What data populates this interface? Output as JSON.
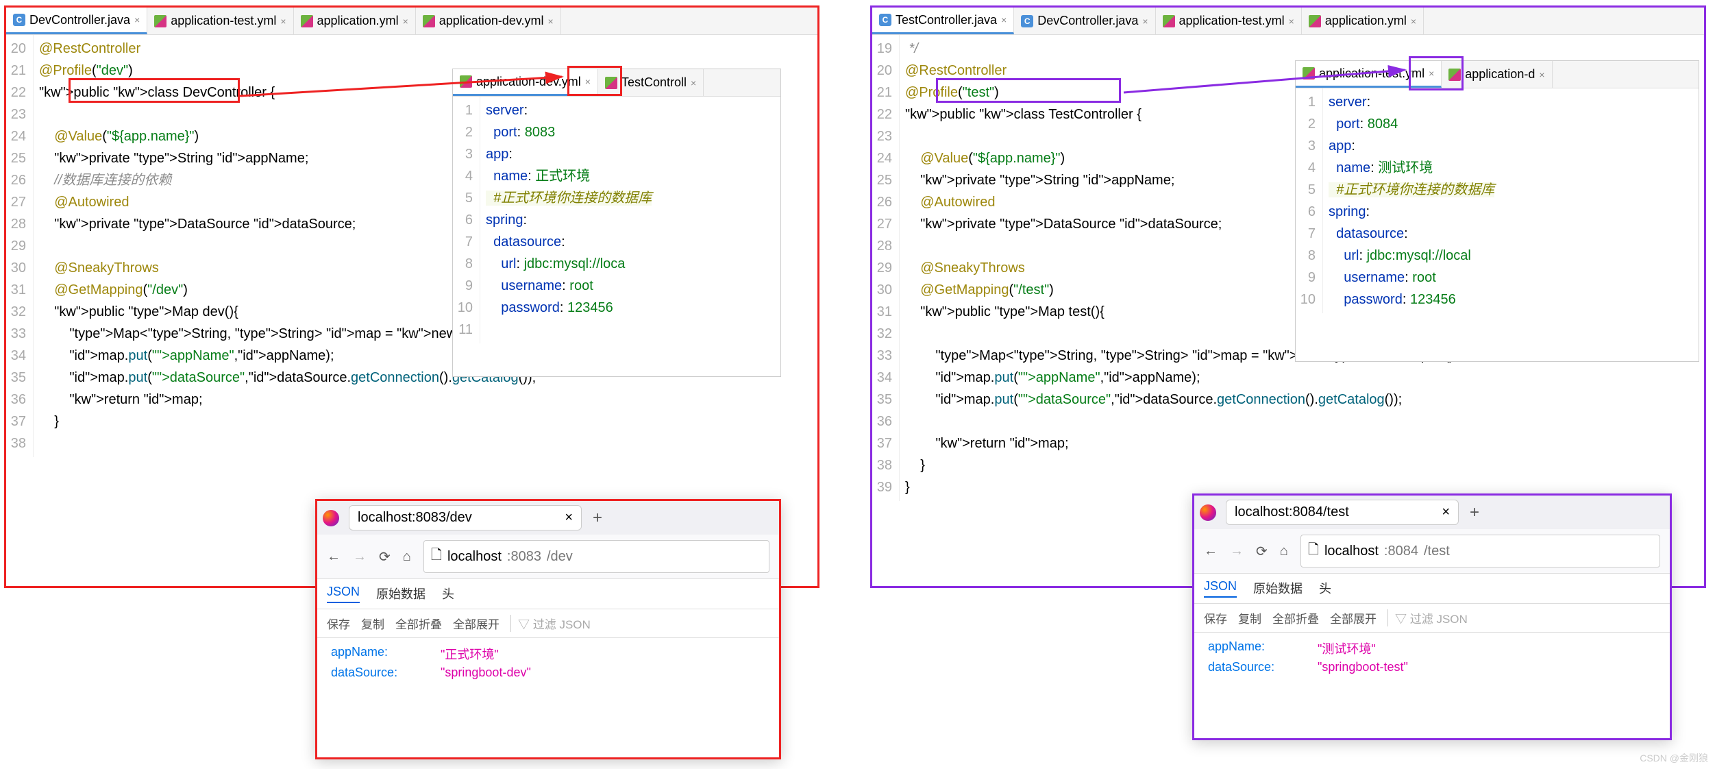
{
  "left": {
    "border_color": "#e22",
    "tabs": [
      "DevController.java",
      "application-test.yml",
      "application.yml",
      "application-dev.yml"
    ],
    "active_tab": 0,
    "code_start_line": 20,
    "code_lines": [
      {
        "n": 20,
        "t": "@RestController",
        "cls": "ann"
      },
      {
        "n": 21,
        "t": "@Profile(\"dev\")",
        "cls": "ann-str"
      },
      {
        "n": 22,
        "t": "public class DevController {",
        "cls": "sig"
      },
      {
        "n": 23,
        "t": "",
        "cls": ""
      },
      {
        "n": 24,
        "t": "    @Value(\"${app.name}\")",
        "cls": "ann-str"
      },
      {
        "n": 25,
        "t": "    private String appName;",
        "cls": "decl"
      },
      {
        "n": 26,
        "t": "    //数据库连接的依赖",
        "cls": "cmt"
      },
      {
        "n": 27,
        "t": "    @Autowired",
        "cls": "ann"
      },
      {
        "n": 28,
        "t": "    private DataSource dataSource;",
        "cls": "decl"
      },
      {
        "n": 29,
        "t": "",
        "cls": ""
      },
      {
        "n": 30,
        "t": "    @SneakyThrows",
        "cls": "ann"
      },
      {
        "n": 31,
        "t": "    @GetMapping(\"/dev\")",
        "cls": "ann-str"
      },
      {
        "n": 32,
        "t": "    public Map dev(){",
        "cls": "sig"
      },
      {
        "n": 33,
        "t": "        Map<String, String> map = new HashMap<>();",
        "cls": "stmt"
      },
      {
        "n": 34,
        "t": "        map.put(\"appName\",appName);",
        "cls": "stmt"
      },
      {
        "n": 35,
        "t": "        map.put(\"dataSource\",dataSource.getConnection().getCatalog());",
        "cls": "stmt"
      },
      {
        "n": 36,
        "t": "        return map;",
        "cls": "ret"
      },
      {
        "n": 37,
        "t": "    }",
        "cls": ""
      },
      {
        "n": 38,
        "t": "",
        "cls": ""
      }
    ],
    "yml": {
      "tabs": [
        "application-dev.yml",
        "TestControll"
      ],
      "lines": [
        {
          "n": 1,
          "t": "server:"
        },
        {
          "n": 2,
          "t": "  port: 8083"
        },
        {
          "n": 3,
          "t": "app:"
        },
        {
          "n": 4,
          "t": "  name: 正式环境"
        },
        {
          "n": 5,
          "t": "  #正式环境你连接的数据库",
          "cmt": true
        },
        {
          "n": 6,
          "t": "spring:"
        },
        {
          "n": 7,
          "t": "  datasource:"
        },
        {
          "n": 8,
          "t": "    url: jdbc:mysql://loca"
        },
        {
          "n": 9,
          "t": "    username: root"
        },
        {
          "n": 10,
          "t": "    password: 123456"
        },
        {
          "n": 11,
          "t": ""
        }
      ]
    },
    "browser": {
      "tab_title": "localhost:8083/dev",
      "url_host": "localhost",
      "url_port": ":8083",
      "url_path": "/dev",
      "subtabs": [
        "JSON",
        "原始数据",
        "头"
      ],
      "toolbar": [
        "保存",
        "复制",
        "全部折叠",
        "全部展开"
      ],
      "filter_ph": "过滤 JSON",
      "json": {
        "appName": "\"正式环境\"",
        "dataSource": "\"springboot-dev\""
      }
    }
  },
  "right": {
    "border_color": "#8a2be2",
    "tabs": [
      "TestController.java",
      "DevController.java",
      "application-test.yml",
      "application.yml"
    ],
    "active_tab": 0,
    "code_lines": [
      {
        "n": 19,
        "t": " */",
        "cls": "cmt"
      },
      {
        "n": 20,
        "t": "@RestController",
        "cls": "ann"
      },
      {
        "n": 21,
        "t": "@Profile(\"test\")",
        "cls": "ann-str"
      },
      {
        "n": 22,
        "t": "public class TestController {",
        "cls": "sig"
      },
      {
        "n": 23,
        "t": "",
        "cls": ""
      },
      {
        "n": 24,
        "t": "    @Value(\"${app.name}\")",
        "cls": "ann-str"
      },
      {
        "n": 25,
        "t": "    private String appName;",
        "cls": "decl"
      },
      {
        "n": 26,
        "t": "    @Autowired",
        "cls": "ann"
      },
      {
        "n": 27,
        "t": "    private DataSource dataSource;",
        "cls": "decl"
      },
      {
        "n": 28,
        "t": "",
        "cls": ""
      },
      {
        "n": 29,
        "t": "    @SneakyThrows",
        "cls": "ann"
      },
      {
        "n": 30,
        "t": "    @GetMapping(\"/test\")",
        "cls": "ann-str"
      },
      {
        "n": 31,
        "t": "    public Map test(){",
        "cls": "sig"
      },
      {
        "n": 32,
        "t": "",
        "cls": ""
      },
      {
        "n": 33,
        "t": "        Map<String, String> map = new HashMap<>();",
        "cls": "stmt"
      },
      {
        "n": 34,
        "t": "        map.put(\"appName\",appName);",
        "cls": "stmt"
      },
      {
        "n": 35,
        "t": "        map.put(\"dataSource\",dataSource.getConnection().getCatalog());",
        "cls": "stmt"
      },
      {
        "n": 36,
        "t": "",
        "cls": ""
      },
      {
        "n": 37,
        "t": "        return map;",
        "cls": "ret"
      },
      {
        "n": 38,
        "t": "    }",
        "cls": ""
      },
      {
        "n": 39,
        "t": "}",
        "cls": ""
      }
    ],
    "yml": {
      "tabs": [
        "application-test.yml",
        "application-d"
      ],
      "lines": [
        {
          "n": 1,
          "t": "server:"
        },
        {
          "n": 2,
          "t": "  port: 8084"
        },
        {
          "n": 3,
          "t": "app:"
        },
        {
          "n": 4,
          "t": "  name: 测试环境"
        },
        {
          "n": 5,
          "t": "  #正式环境你连接的数据库",
          "cmt": true
        },
        {
          "n": 6,
          "t": "spring:"
        },
        {
          "n": 7,
          "t": "  datasource:"
        },
        {
          "n": 8,
          "t": "    url: jdbc:mysql://local"
        },
        {
          "n": 9,
          "t": "    username: root"
        },
        {
          "n": 10,
          "t": "    password: 123456"
        }
      ]
    },
    "browser": {
      "tab_title": "localhost:8084/test",
      "url_host": "localhost",
      "url_port": ":8084",
      "url_path": "/test",
      "subtabs": [
        "JSON",
        "原始数据",
        "头"
      ],
      "toolbar": [
        "保存",
        "复制",
        "全部折叠",
        "全部展开"
      ],
      "filter_ph": "过滤 JSON",
      "json": {
        "appName": "\"测试环境\"",
        "dataSource": "\"springboot-test\""
      }
    }
  },
  "watermark": "CSDN @金刚狼"
}
